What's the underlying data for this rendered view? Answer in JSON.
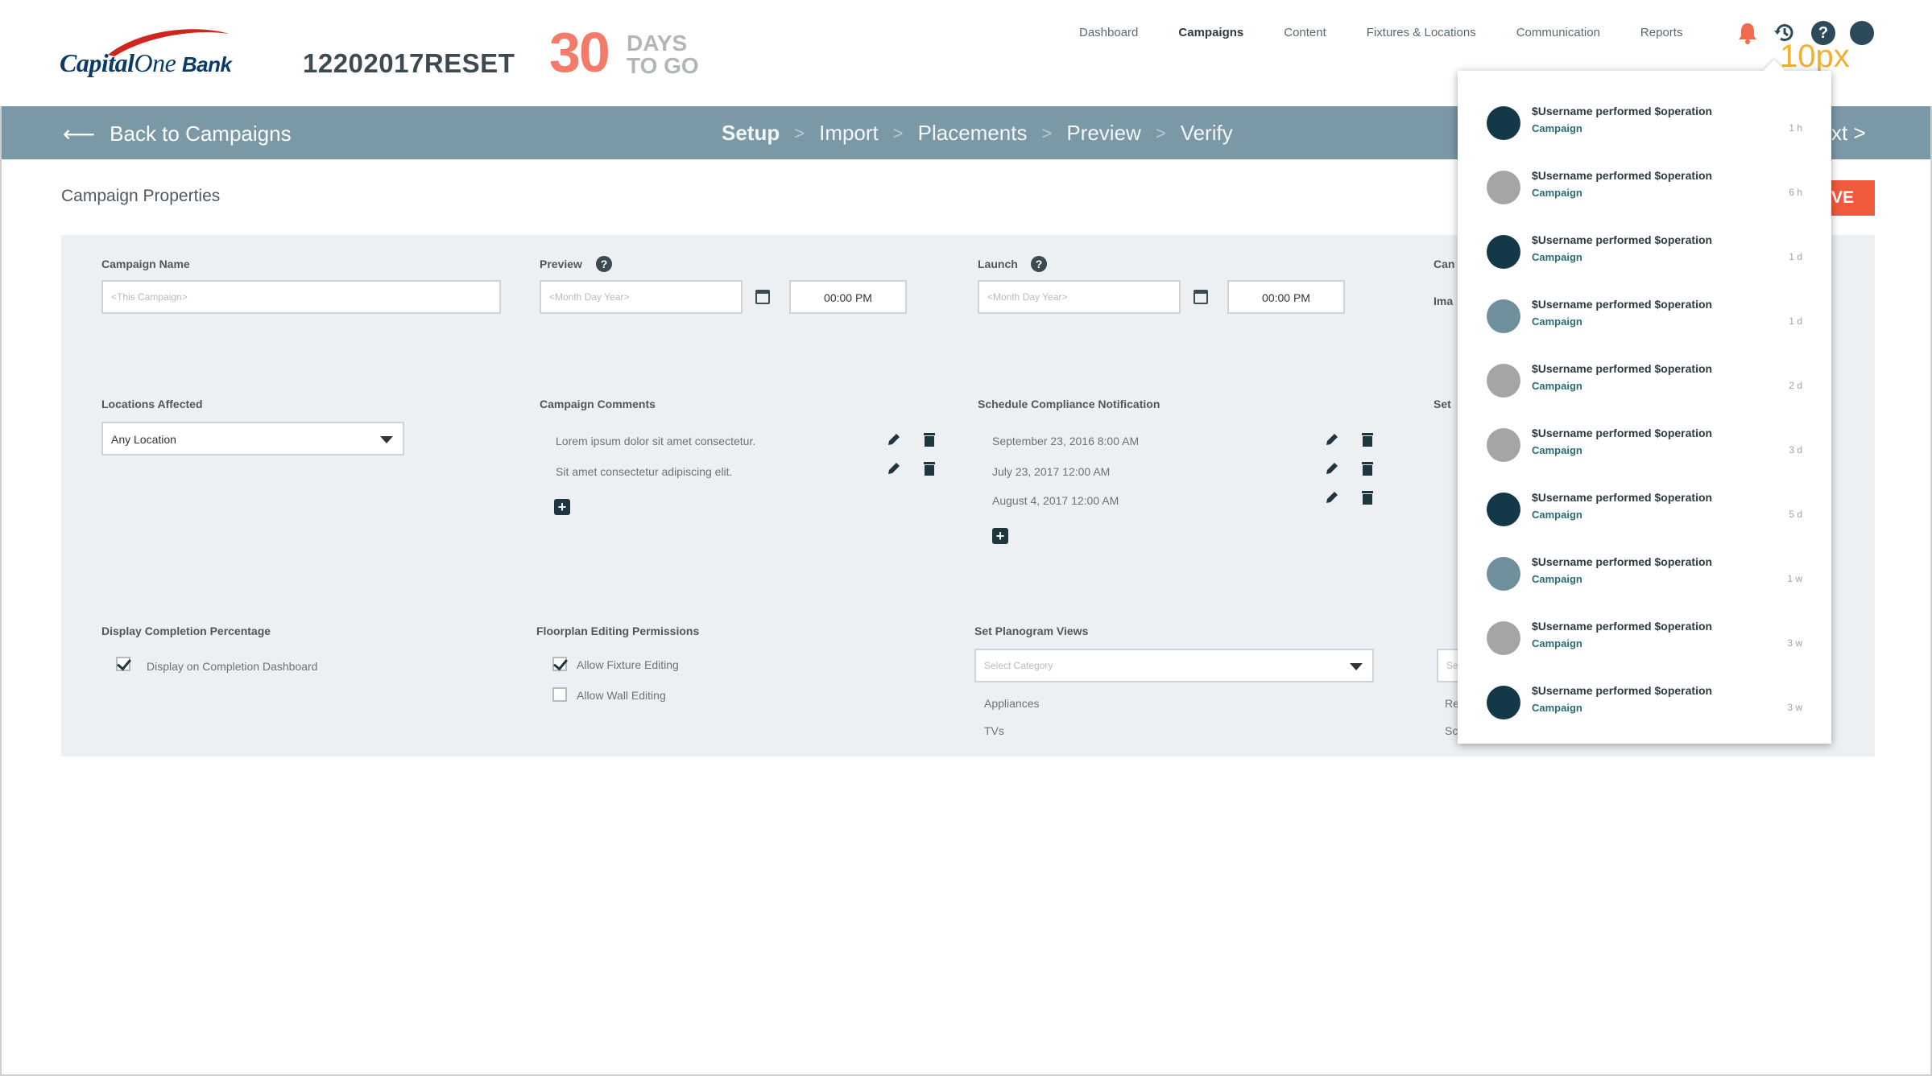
{
  "header": {
    "logo_text": "Capital",
    "logo_one": "One",
    "logo_bank": "Bank",
    "campaign_id": "12202017RESET",
    "days_number": "30",
    "days_label_1": "DAYS",
    "days_label_2": "TO GO",
    "nav": [
      "Dashboard",
      "Campaigns",
      "Content",
      "Fixtures & Locations",
      "Communication",
      "Reports"
    ],
    "active_nav": "Campaigns",
    "help_label": "?",
    "px_note": "10px"
  },
  "subbar": {
    "back_label": "Back to Campaigns",
    "steps": [
      "Setup",
      "Import",
      "Placements",
      "Preview",
      "Verify"
    ],
    "separator": ">",
    "next_fragment": "xt >"
  },
  "page": {
    "title": "Campaign Properties",
    "save_fragment": "VE"
  },
  "form": {
    "campaign_name": {
      "label": "Campaign Name",
      "placeholder": "<This Campaign>"
    },
    "preview": {
      "label": "Preview",
      "date_placeholder": "<Month Day Year>",
      "time": "00:00  PM"
    },
    "launch": {
      "label": "Launch",
      "date_placeholder": "<Month Day Year>",
      "time": "00:00  PM"
    },
    "col4_label_fragment": "Can",
    "col4_text_fragment": "Ima",
    "locations": {
      "label": "Locations Affected",
      "value": "Any Location"
    },
    "comments": {
      "label": "Campaign Comments",
      "items": [
        "Lorem ipsum dolor sit amet consectetur.",
        "Sit amet consectetur adipiscing elit."
      ]
    },
    "compliance": {
      "label": "Schedule Compliance Notification",
      "items": [
        "September 23, 2016   8:00 AM",
        "July 23, 2017   12:00 AM",
        "August 4, 2017   12:00 AM"
      ]
    },
    "set_fragment": "Set",
    "display_completion": {
      "label": "Display Completion Percentage",
      "option": "Display on Completion Dashboard",
      "checked": true
    },
    "floorplan": {
      "label": "Floorplan Editing Permissions",
      "options": [
        {
          "text": "Allow Fixture Editing",
          "checked": true
        },
        {
          "text": "Allow Wall Editing",
          "checked": false
        }
      ]
    },
    "planogram": {
      "label": "Set Planogram Views",
      "placeholder": "Select Category",
      "items": [
        "Appliances",
        "TVs"
      ]
    },
    "right_fragments": [
      "Se",
      "Re",
      "Sc"
    ]
  },
  "activity": {
    "items": [
      {
        "message": "$Username performed $operation",
        "link": "Campaign",
        "time": "1 h",
        "color": "#143848"
      },
      {
        "message": "$Username performed $operation",
        "link": "Campaign",
        "time": "6 h",
        "color": "#a3a5a6"
      },
      {
        "message": "$Username performed $operation",
        "link": "Campaign",
        "time": "1 d",
        "color": "#143848"
      },
      {
        "message": "$Username performed $operation",
        "link": "Campaign",
        "time": "1 d",
        "color": "#6f8f9c"
      },
      {
        "message": "$Username performed $operation",
        "link": "Campaign",
        "time": "2 d",
        "color": "#a3a5a6"
      },
      {
        "message": "$Username performed $operation",
        "link": "Campaign",
        "time": "3 d",
        "color": "#a3a5a6"
      },
      {
        "message": "$Username performed $operation",
        "link": "Campaign",
        "time": "5 d",
        "color": "#143848"
      },
      {
        "message": "$Username performed $operation",
        "link": "Campaign",
        "time": "1 w",
        "color": "#6f8f9c"
      },
      {
        "message": "$Username performed $operation",
        "link": "Campaign",
        "time": "3 w",
        "color": "#a3a5a6"
      },
      {
        "message": "$Username performed $operation",
        "link": "Campaign",
        "time": "3 w",
        "color": "#143848"
      }
    ]
  },
  "colors": {
    "accent": "#f47a6a",
    "subbar": "#7b98a7",
    "save": "#f05a3c",
    "panel": "#ecf0f2"
  }
}
